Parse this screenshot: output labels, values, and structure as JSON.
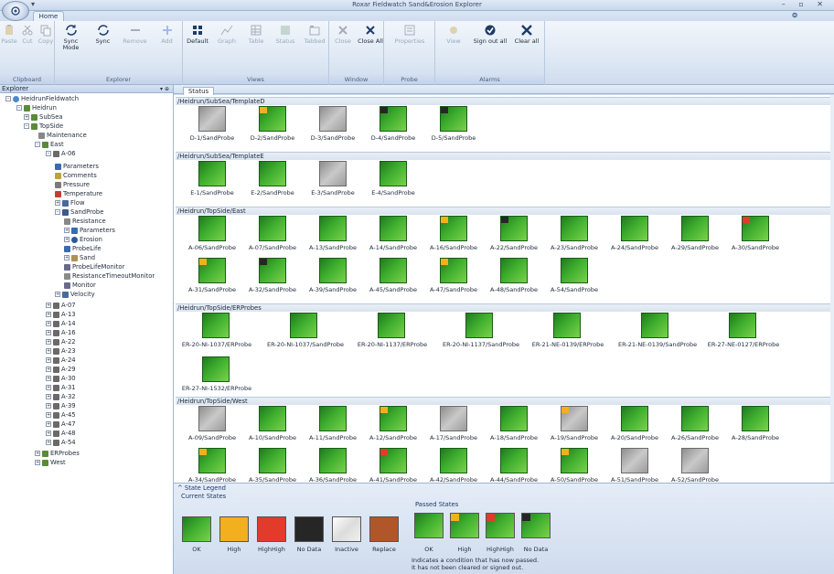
{
  "window": {
    "title": "Roxar Fieldwatch Sand&Erosion Explorer",
    "controls": "–  ▫  ✕"
  },
  "ribbon": {
    "home_tab": "Home",
    "help": "❂",
    "groups": [
      {
        "label": "Clipboard",
        "buttons": [
          {
            "name": "paste",
            "label": "Paste",
            "enabled": false
          },
          {
            "name": "cut",
            "label": "Cut",
            "enabled": false
          },
          {
            "name": "copy",
            "label": "Copy",
            "enabled": false
          }
        ]
      },
      {
        "label": "Explorer",
        "buttons": [
          {
            "name": "sync-mode",
            "label": "Sync Mode",
            "enabled": true
          },
          {
            "name": "sync",
            "label": "Sync",
            "enabled": true
          },
          {
            "name": "remove",
            "label": "Remove",
            "enabled": false
          },
          {
            "name": "add",
            "label": "Add",
            "enabled": false
          }
        ]
      },
      {
        "label": "Views",
        "buttons": [
          {
            "name": "default",
            "label": "Default",
            "enabled": true
          },
          {
            "name": "graph",
            "label": "Graph",
            "enabled": false
          },
          {
            "name": "table",
            "label": "Table",
            "enabled": false
          },
          {
            "name": "status",
            "label": "Status",
            "enabled": false
          },
          {
            "name": "tabbed",
            "label": "Tabbed",
            "enabled": false
          }
        ]
      },
      {
        "label": "Window",
        "buttons": [
          {
            "name": "close",
            "label": "Close",
            "enabled": false
          },
          {
            "name": "close-all",
            "label": "Close All",
            "enabled": true
          }
        ]
      },
      {
        "label": "Probe",
        "buttons": [
          {
            "name": "properties",
            "label": "Properties",
            "enabled": false
          }
        ]
      },
      {
        "label": "Alarms",
        "buttons": [
          {
            "name": "view",
            "label": "View",
            "enabled": false
          },
          {
            "name": "sign-out-all",
            "label": "Sign out all",
            "enabled": true
          },
          {
            "name": "clear-all",
            "label": "Clear all",
            "enabled": true
          }
        ]
      }
    ]
  },
  "explorer": {
    "title": "Explorer",
    "pin": "▾ ⊕",
    "tree": [
      {
        "label": "HeidrunFieldwatch",
        "toggle": "–",
        "icon": "globe"
      },
      {
        "label": "Heidrun",
        "toggle": "–",
        "icon": "site"
      },
      {
        "label": "SubSea",
        "toggle": "+",
        "icon": "site"
      },
      {
        "label": "TopSide",
        "toggle": "–",
        "icon": "site"
      },
      {
        "label": "Maintenance",
        "toggle": "",
        "icon": "wrench"
      },
      {
        "label": "East",
        "toggle": "–",
        "icon": "site"
      },
      {
        "label": "A-06",
        "toggle": "–",
        "icon": "well"
      },
      {
        "label": "Parameters",
        "toggle": "",
        "icon": "param"
      },
      {
        "label": "Comments",
        "toggle": "",
        "icon": "note"
      },
      {
        "label": "Pressure",
        "toggle": "",
        "icon": "gauge"
      },
      {
        "label": "Temperature",
        "toggle": "",
        "icon": "thermo"
      },
      {
        "label": "Flow",
        "toggle": "+",
        "icon": "flow"
      },
      {
        "label": "SandProbe",
        "toggle": "–",
        "icon": "probe"
      },
      {
        "label": "Resistance",
        "toggle": "",
        "icon": "res"
      },
      {
        "label": "Parameters",
        "toggle": "+",
        "icon": "param"
      },
      {
        "label": "Erosion",
        "toggle": "+",
        "icon": "ring"
      },
      {
        "label": "ProbeLife",
        "toggle": "",
        "icon": "pin"
      },
      {
        "label": "Sand",
        "toggle": "+",
        "icon": "sand"
      },
      {
        "label": "ProbeLifeMonitor",
        "toggle": "",
        "icon": "monitor"
      },
      {
        "label": "ResistanceTimeoutMonitor",
        "toggle": "",
        "icon": "clock"
      },
      {
        "label": "Monitor",
        "toggle": "",
        "icon": "monitor"
      },
      {
        "label": "Velocity",
        "toggle": "+",
        "icon": "flow"
      },
      {
        "label": "A-07",
        "toggle": "+",
        "icon": "well"
      },
      {
        "label": "A-13",
        "toggle": "+",
        "icon": "well"
      },
      {
        "label": "A-14",
        "toggle": "+",
        "icon": "well"
      },
      {
        "label": "A-16",
        "toggle": "+",
        "icon": "well"
      },
      {
        "label": "A-22",
        "toggle": "+",
        "icon": "well"
      },
      {
        "label": "A-23",
        "toggle": "+",
        "icon": "well"
      },
      {
        "label": "A-24",
        "toggle": "+",
        "icon": "well"
      },
      {
        "label": "A-29",
        "toggle": "+",
        "icon": "well"
      },
      {
        "label": "A-30",
        "toggle": "+",
        "icon": "well"
      },
      {
        "label": "A-31",
        "toggle": "+",
        "icon": "well"
      },
      {
        "label": "A-32",
        "toggle": "+",
        "icon": "well"
      },
      {
        "label": "A-39",
        "toggle": "+",
        "icon": "well"
      },
      {
        "label": "A-45",
        "toggle": "+",
        "icon": "well"
      },
      {
        "label": "A-47",
        "toggle": "+",
        "icon": "well"
      },
      {
        "label": "A-48",
        "toggle": "+",
        "icon": "well"
      },
      {
        "label": "A-54",
        "toggle": "+",
        "icon": "well"
      },
      {
        "label": "ERProbes",
        "toggle": "+",
        "icon": "site"
      },
      {
        "label": "West",
        "toggle": "+",
        "icon": "site"
      }
    ]
  },
  "status_tab": "Status",
  "sections": [
    {
      "title": "/Heidrun/SubSea/TemplateD",
      "probes": [
        {
          "label": "D-1/SandProbe",
          "state": "inactive",
          "flag": ""
        },
        {
          "label": "D-2/SandProbe",
          "state": "ok",
          "flag": "high"
        },
        {
          "label": "D-3/SandProbe",
          "state": "inactive",
          "flag": ""
        },
        {
          "label": "D-4/SandProbe",
          "state": "ok",
          "flag": "nodata"
        },
        {
          "label": "D-5/SandProbe",
          "state": "ok",
          "flag": "nodata"
        }
      ]
    },
    {
      "title": "/Heidrun/SubSea/TemplateE",
      "probes": [
        {
          "label": "E-1/SandProbe",
          "state": "ok",
          "flag": ""
        },
        {
          "label": "E-2/SandProbe",
          "state": "ok",
          "flag": ""
        },
        {
          "label": "E-3/SandProbe",
          "state": "inactive",
          "flag": ""
        },
        {
          "label": "E-4/SandProbe",
          "state": "ok",
          "flag": ""
        }
      ]
    },
    {
      "title": "/Heidrun/TopSide/East",
      "probes": [
        {
          "label": "A-06/SandProbe",
          "state": "ok",
          "flag": ""
        },
        {
          "label": "A-07/SandProbe",
          "state": "ok",
          "flag": ""
        },
        {
          "label": "A-13/SandProbe",
          "state": "ok",
          "flag": ""
        },
        {
          "label": "A-14/SandProbe",
          "state": "ok",
          "flag": ""
        },
        {
          "label": "A-16/SandProbe",
          "state": "ok",
          "flag": "high"
        },
        {
          "label": "A-22/SandProbe",
          "state": "ok",
          "flag": "nodata"
        },
        {
          "label": "A-23/SandProbe",
          "state": "ok",
          "flag": ""
        },
        {
          "label": "A-24/SandProbe",
          "state": "ok",
          "flag": ""
        },
        {
          "label": "A-29/SandProbe",
          "state": "ok",
          "flag": ""
        },
        {
          "label": "A-30/SandProbe",
          "state": "ok",
          "flag": "highhigh"
        },
        {
          "label": "A-31/SandProbe",
          "state": "ok",
          "flag": "high"
        },
        {
          "label": "A-32/SandProbe",
          "state": "ok",
          "flag": "nodata"
        },
        {
          "label": "A-39/SandProbe",
          "state": "ok",
          "flag": ""
        },
        {
          "label": "A-45/SandProbe",
          "state": "ok",
          "flag": ""
        },
        {
          "label": "A-47/SandProbe",
          "state": "ok",
          "flag": "high"
        },
        {
          "label": "A-48/SandProbe",
          "state": "ok",
          "flag": ""
        },
        {
          "label": "A-54/SandProbe",
          "state": "ok",
          "flag": ""
        }
      ]
    },
    {
      "title": "/Heidrun/TopSide/ERProbes",
      "probes": [
        {
          "label": "ER-20-NI-1037/ERProbe",
          "state": "ok",
          "flag": ""
        },
        {
          "label": "ER-20-NI-1037/SandProbe",
          "state": "ok",
          "flag": ""
        },
        {
          "label": "ER-20-NI-1137/ERProbe",
          "state": "ok",
          "flag": ""
        },
        {
          "label": "ER-20-NI-1137/SandProbe",
          "state": "ok",
          "flag": ""
        },
        {
          "label": "ER-21-NE-0139/ERProbe",
          "state": "ok",
          "flag": ""
        },
        {
          "label": "ER-21-NE-0139/SandProbe",
          "state": "ok",
          "flag": ""
        },
        {
          "label": "ER-27-NE-0127/ERProbe",
          "state": "ok",
          "flag": ""
        },
        {
          "label": "ER-27-NI-1532/ERProbe",
          "state": "ok",
          "flag": ""
        }
      ]
    },
    {
      "title": "/Heidrun/TopSide/West",
      "probes": [
        {
          "label": "A-09/SandProbe",
          "state": "inactive",
          "flag": ""
        },
        {
          "label": "A-10/SandProbe",
          "state": "ok",
          "flag": ""
        },
        {
          "label": "A-11/SandProbe",
          "state": "ok",
          "flag": ""
        },
        {
          "label": "A-12/SandProbe",
          "state": "ok",
          "flag": "high"
        },
        {
          "label": "A-17/SandProbe",
          "state": "inactive",
          "flag": ""
        },
        {
          "label": "A-18/SandProbe",
          "state": "ok",
          "flag": ""
        },
        {
          "label": "A-19/SandProbe",
          "state": "inactive",
          "flag": "high"
        },
        {
          "label": "A-20/SandProbe",
          "state": "ok",
          "flag": ""
        },
        {
          "label": "A-26/SandProbe",
          "state": "ok",
          "flag": ""
        },
        {
          "label": "A-28/SandProbe",
          "state": "ok",
          "flag": ""
        },
        {
          "label": "A-34/SandProbe",
          "state": "ok",
          "flag": "high"
        },
        {
          "label": "A-35/SandProbe",
          "state": "ok",
          "flag": ""
        },
        {
          "label": "A-36/SandProbe",
          "state": "ok",
          "flag": ""
        },
        {
          "label": "A-41/SandProbe",
          "state": "ok",
          "flag": "highhigh"
        },
        {
          "label": "A-42/SandProbe",
          "state": "ok",
          "flag": ""
        },
        {
          "label": "A-44/SandProbe",
          "state": "ok",
          "flag": ""
        },
        {
          "label": "A-50/SandProbe",
          "state": "ok",
          "flag": "high"
        },
        {
          "label": "A-51/SandProbe",
          "state": "inactive",
          "flag": ""
        },
        {
          "label": "A-52/SandProbe",
          "state": "inactive",
          "flag": ""
        }
      ]
    }
  ],
  "legend": {
    "title": "State Legend",
    "toggle": "^",
    "current_title": "Current States",
    "passed_title": "Passed States",
    "current": [
      {
        "label": "OK",
        "color": "#2f9a2a"
      },
      {
        "label": "High",
        "color": "#f2b01e"
      },
      {
        "label": "HighHigh",
        "color": "#e23b2a"
      },
      {
        "label": "No Data",
        "color": "#262626"
      },
      {
        "label": "Inactive",
        "color": "#e6e6e6"
      },
      {
        "label": "Replace",
        "color": "#b0562a"
      }
    ],
    "passed": [
      {
        "label": "OK",
        "flag": ""
      },
      {
        "label": "High",
        "flag": "#f2b01e"
      },
      {
        "label": "HighHigh",
        "flag": "#e23b2a"
      },
      {
        "label": "No Data",
        "flag": "#262626"
      }
    ],
    "note_line1": "Indicates a condition that has now passed.",
    "note_line2": "It has not been cleared or signed out."
  },
  "colors": {
    "high": "#f2b01e",
    "highhigh": "#e23b2a",
    "nodata": "#262626"
  }
}
